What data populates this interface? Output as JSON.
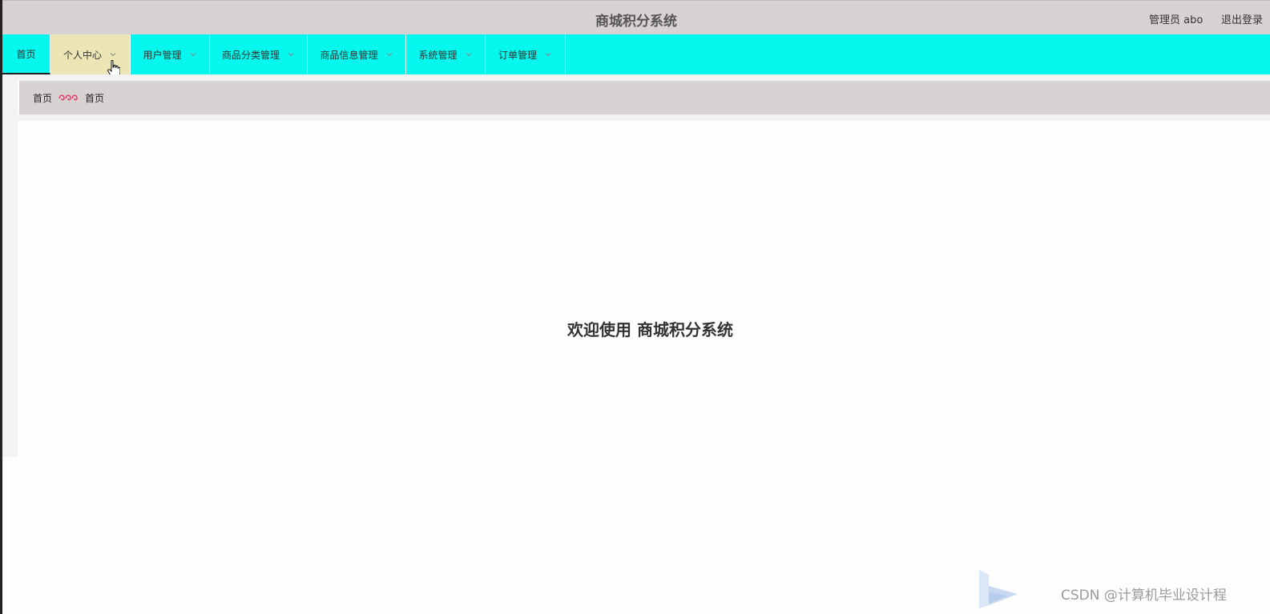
{
  "header": {
    "title": "商城积分系统",
    "user_label": "管理员 abo",
    "logout_label": "退出登录"
  },
  "nav": {
    "items": [
      {
        "label": "首页"
      },
      {
        "label": "个人中心"
      },
      {
        "label": "用户管理"
      },
      {
        "label": "商品分类管理"
      },
      {
        "label": "商品信息管理"
      },
      {
        "label": "系统管理"
      },
      {
        "label": "订单管理"
      }
    ]
  },
  "breadcrumb": {
    "root": "首页",
    "current": "首页"
  },
  "main": {
    "welcome": "欢迎使用 商城积分系统"
  },
  "watermark": {
    "text": "CSDN @计算机毕业设计程"
  },
  "colors": {
    "nav_bg": "#05f7ee",
    "header_bg": "#d8d2d3",
    "active_item": "#ece6b6",
    "separator": "#e8436a"
  },
  "icons": {
    "chevron": "chevron-down-icon",
    "separator": "wave-separator-icon",
    "cursor": "hand-pointer-cursor"
  }
}
